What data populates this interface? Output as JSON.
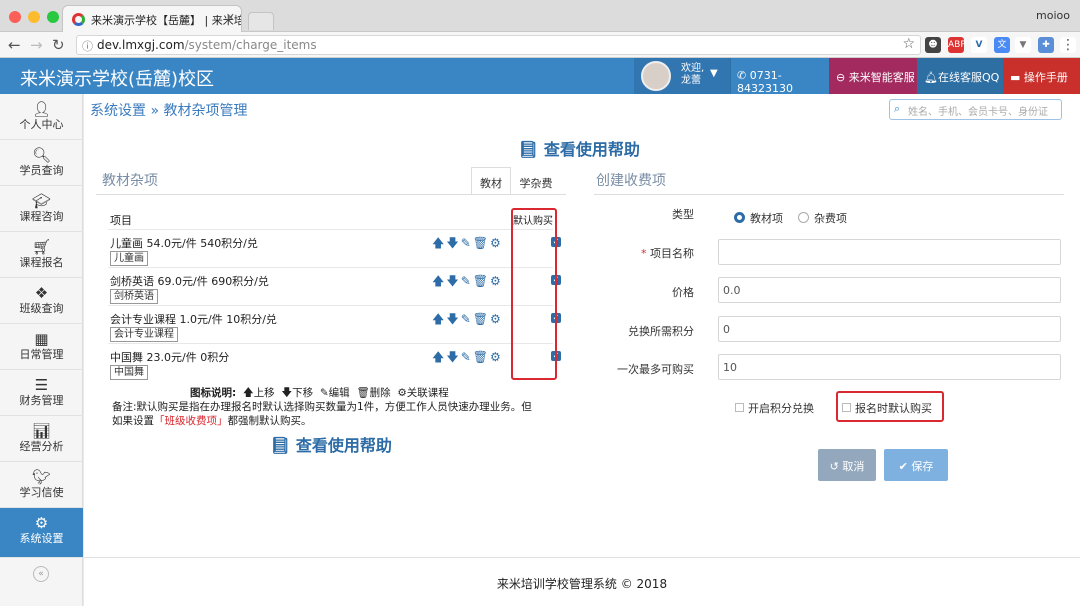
{
  "browser": {
    "tab_title": "来米演示学校【岳麓】 | 来米培",
    "profile": "moioo",
    "url_host": "dev.lmxgj.com",
    "url_path": "/system/charge_items"
  },
  "header": {
    "school_name": "来米演示学校(岳麓)校区",
    "welcome_line1": "欢迎,",
    "welcome_line2": "龙蕾",
    "phone": "0731-84323130",
    "smart_service": "来米智能客服",
    "qq_service": "在线客服QQ",
    "manual": "操作手册"
  },
  "sidebar": {
    "items": [
      {
        "label": "个人中心",
        "icon": "user-icon"
      },
      {
        "label": "学员查询",
        "icon": "search-icon"
      },
      {
        "label": "课程咨询",
        "icon": "graduation-cap-icon"
      },
      {
        "label": "课程报名",
        "icon": "cart-icon"
      },
      {
        "label": "班级查询",
        "icon": "cubes-icon"
      },
      {
        "label": "日常管理",
        "icon": "calendar-icon"
      },
      {
        "label": "财务管理",
        "icon": "list-icon"
      },
      {
        "label": "经营分析",
        "icon": "bar-chart-icon"
      },
      {
        "label": "学习信使",
        "icon": "twitter-bird-icon"
      },
      {
        "label": "系统设置",
        "icon": "cogs-icon",
        "active": true
      }
    ]
  },
  "main": {
    "breadcrumb": "系统设置 » 教材杂项管理",
    "search_placeholder": "姓名、手机、会员卡号、身份证",
    "help_link": "查看使用帮助",
    "left_section_title": "教材杂项",
    "right_section_title": "创建收费项",
    "tabs": [
      "教材",
      "学杂费"
    ],
    "table": {
      "col_item": "项目",
      "col_default": "默认购买",
      "rows": [
        {
          "desc": "儿童画  54.0元/件 540积分/兑",
          "tag": "儿童画",
          "checked": true
        },
        {
          "desc": "剑桥英语  69.0元/件 690积分/兑",
          "tag": "剑桥英语",
          "checked": true
        },
        {
          "desc": "会计专业课程  1.0元/件 10积分/兑",
          "tag": "会计专业课程",
          "checked": true
        },
        {
          "desc": "中国舞  23.0元/件 0积分",
          "tag": "中国舞",
          "checked": true
        }
      ]
    },
    "legend": {
      "title": "图标说明:",
      "up": "上移",
      "down": "下移",
      "edit": "编辑",
      "delete": "删除",
      "link": "关联课程"
    },
    "note_prefix": "备注:默认购买是指在办理报名时默认选择购买数量为1件，方便工作人员快速办理业务。但如果设置",
    "note_link": "「班级收费项」",
    "note_suffix": "都强制默认购买。",
    "form": {
      "type_label": "类型",
      "type_option1": "教材项",
      "type_option2": "杂费项",
      "name_label": "项目名称",
      "price_label": "价格",
      "price_value": "0.0",
      "points_label": "兑换所需积分",
      "points_value": "0",
      "max_label": "一次最多可购买",
      "max_value": "10",
      "enable_points": "开启积分兑换",
      "default_buy": "报名时默认购买",
      "cancel": "取消",
      "save": "保存"
    },
    "footer": "来米培训学校管理系统 © 2018"
  },
  "colors": {
    "header_bg": "#3a86c4",
    "accent": "#2d6ca6",
    "highlight_box": "#d9282f",
    "smart_service_bg": "#a22a5f",
    "manual_bg": "#c9302c"
  }
}
